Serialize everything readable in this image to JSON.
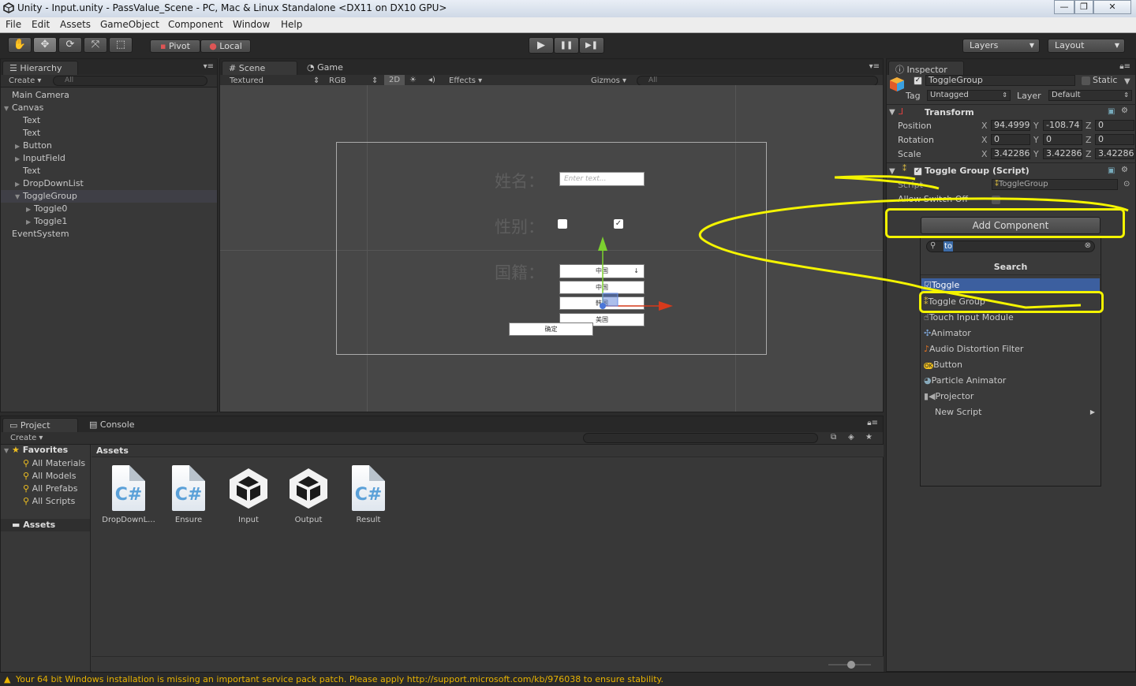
{
  "window": {
    "title": "Unity - Input.unity - PassValue_Scene - PC, Mac & Linux Standalone <DX11 on DX10 GPU>",
    "minimize": "—",
    "maximize": "❐",
    "close": "✕"
  },
  "menu": [
    "File",
    "Edit",
    "Assets",
    "GameObject",
    "Component",
    "Window",
    "Help"
  ],
  "toolbar": {
    "tools": [
      "hand-icon",
      "move-icon",
      "rotate-icon",
      "scale-icon",
      "rect-icon"
    ],
    "pivot": "Pivot",
    "local": "Local",
    "play": "▶",
    "pause": "❚❚",
    "step": "▶❚",
    "layers": "Layers",
    "layout": "Layout"
  },
  "hierarchy": {
    "tab": "Hierarchy",
    "create": "Create",
    "search": "All",
    "items": [
      {
        "label": "Main Camera",
        "indent": 0,
        "arrow": ""
      },
      {
        "label": "Canvas",
        "indent": 0,
        "arrow": "▼"
      },
      {
        "label": "Text",
        "indent": 1,
        "arrow": ""
      },
      {
        "label": "Text",
        "indent": 1,
        "arrow": ""
      },
      {
        "label": "Button",
        "indent": 1,
        "arrow": "▶"
      },
      {
        "label": "InputField",
        "indent": 1,
        "arrow": "▶"
      },
      {
        "label": "Text",
        "indent": 1,
        "arrow": ""
      },
      {
        "label": "DropDownList",
        "indent": 1,
        "arrow": "▶"
      },
      {
        "label": "ToggleGroup",
        "indent": 1,
        "arrow": "▼",
        "selected": true
      },
      {
        "label": "Toggle0",
        "indent": 2,
        "arrow": "▶"
      },
      {
        "label": "Toggle1",
        "indent": 2,
        "arrow": "▶"
      },
      {
        "label": "EventSystem",
        "indent": 0,
        "arrow": ""
      }
    ]
  },
  "scene": {
    "tab_scene": "Scene",
    "tab_game": "Game",
    "shading": "Textured",
    "render": "RGB",
    "mode2d": "2D",
    "effects": "Effects",
    "gizmos": "Gizmos",
    "search": "All",
    "canvas": {
      "name_label": "姓名：",
      "gender_label": "性别：",
      "nation_label": "国籍：",
      "input_placeholder": "Enter text...",
      "dropdown_items": [
        "中国",
        "中国",
        "韩国",
        "美国"
      ],
      "confirm": "确定"
    }
  },
  "project": {
    "tab_project": "Project",
    "tab_console": "Console",
    "create": "Create",
    "favorites_title": "Favorites",
    "favorites": [
      "All Materials",
      "All Models",
      "All Prefabs",
      "All Scripts"
    ],
    "assets_root": "Assets",
    "assets_header": "Assets",
    "assets": [
      {
        "name": "DropDownL...",
        "kind": "cs"
      },
      {
        "name": "Ensure",
        "kind": "cs"
      },
      {
        "name": "Input",
        "kind": "unity"
      },
      {
        "name": "Output",
        "kind": "unity"
      },
      {
        "name": "Result",
        "kind": "cs"
      }
    ]
  },
  "inspector": {
    "tab": "Inspector",
    "object_name": "ToggleGroup",
    "static_label": "Static",
    "tag_label": "Tag",
    "tag_value": "Untagged",
    "layer_label": "Layer",
    "layer_value": "Default",
    "transform": {
      "title": "Transform",
      "position_label": "Position",
      "pos_x": "94.4999",
      "pos_y": "-108.74",
      "pos_z": "0",
      "rotation_label": "Rotation",
      "rot_x": "0",
      "rot_y": "0",
      "rot_z": "0",
      "scale_label": "Scale",
      "scale_x": "3.42286",
      "scale_y": "3.42286",
      "scale_z": "3.42286",
      "x": "X",
      "y": "Y",
      "z": "Z"
    },
    "toggle_group": {
      "title": "Toggle Group (Script)",
      "script_label": "Script",
      "script_value": "ToggleGroup",
      "allow_label": "Allow Switch Off"
    },
    "add_component": "Add Component",
    "search_value": "to",
    "search_title": "Search",
    "results": [
      "Toggle",
      "Toggle Group",
      "Touch Input Module",
      "Animator",
      "Audio Distortion Filter",
      "Button",
      "Particle Animator",
      "Projector",
      "New Script"
    ]
  },
  "status": {
    "message": "Your 64 bit Windows installation is missing an important service pack patch. Please apply http://support.microsoft.com/kb/976038 to ensure stability."
  },
  "colors": {
    "highlight": "#f4f400",
    "selection": "#3c5f9f",
    "warning": "#e8b300"
  }
}
